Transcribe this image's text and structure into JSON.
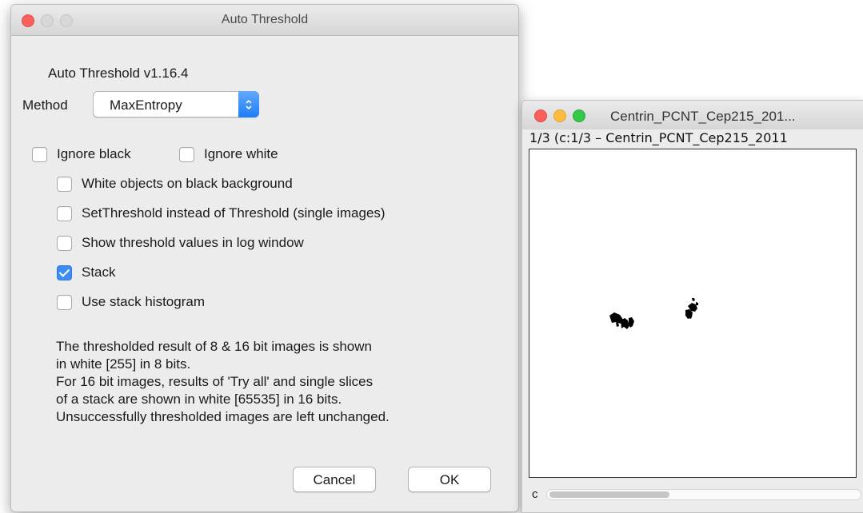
{
  "dialog": {
    "title": "Auto Threshold",
    "heading": "Auto Threshold v1.16.4",
    "method_label": "Method",
    "method_value": "MaxEntropy",
    "checkboxes": [
      {
        "label": "Ignore black",
        "checked": false
      },
      {
        "label": "Ignore white",
        "checked": false
      },
      {
        "label": "White objects on black background",
        "checked": false
      },
      {
        "label": "SetThreshold instead of Threshold (single images)",
        "checked": false
      },
      {
        "label": "Show threshold values in log window",
        "checked": false
      },
      {
        "label": "Stack",
        "checked": true
      },
      {
        "label": "Use stack histogram",
        "checked": false
      }
    ],
    "note_lines": [
      "The thresholded result of 8 & 16 bit images is shown",
      "in white [255] in 8 bits.",
      "For 16 bit images, results of 'Try all' and single slices",
      "of a stack are shown in white [65535] in 16 bits.",
      "Unsuccessfully thresholded images are left unchanged."
    ],
    "cancel_label": "Cancel",
    "ok_label": "OK"
  },
  "image_window": {
    "title": "Centrin_PCNT_Cep215_201...",
    "info": "1/3 (c:1/3 – Centrin_PCNT_Cep215_2011",
    "slider_label": "c",
    "slider_position": 0.0
  },
  "colors": {
    "accent": "#3c8ef6",
    "close": "#fc605c",
    "minimize": "#fdbc40",
    "maximize": "#34c84a"
  }
}
